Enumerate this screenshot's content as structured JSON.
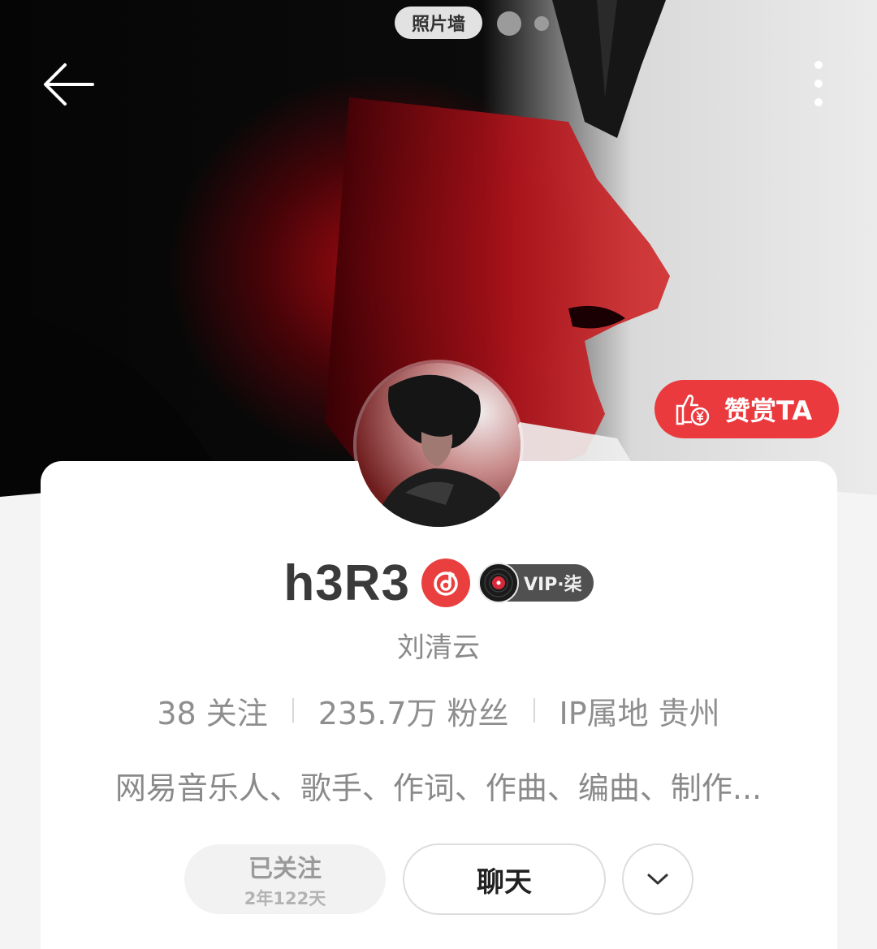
{
  "header": {
    "photo_wall_label": "照片墙",
    "reward_label": "赞赏TA"
  },
  "profile": {
    "username": "h3R3",
    "vip_label": "VIP·柒",
    "real_name": "刘清云",
    "stats": [
      {
        "number": "38",
        "label": "关注"
      },
      {
        "number": "235.7万",
        "label": "粉丝"
      },
      {
        "number": "IP属地",
        "label": "贵州"
      }
    ],
    "bio": "网易音乐人、歌手、作词、作曲、编曲、制作..."
  },
  "actions": {
    "followed_label": "已关注",
    "followed_duration": "2年122天",
    "chat_label": "聊天"
  },
  "icons": {
    "back": "back-arrow-icon",
    "more": "more-vertical-icon",
    "reward": "thumbs-up-yen-icon",
    "musician": "musician-note-icon",
    "vinyl": "vinyl-record-icon",
    "expand": "chevron-down-icon"
  },
  "colors": {
    "accent_red": "#ea3a3e",
    "vip_badge_bg": "#505050",
    "text_secondary": "#8a8a8a"
  }
}
